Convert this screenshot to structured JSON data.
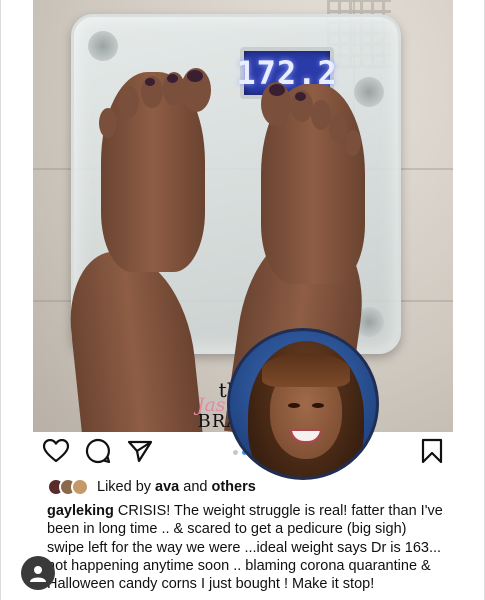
{
  "photo": {
    "scale_reading": "172.2",
    "watermark": {
      "line1": "the",
      "line2": "Jasmine",
      "line3": "BRAND"
    }
  },
  "actions": {
    "icons": [
      "heart-icon",
      "comment-icon",
      "share-icon",
      "bookmark-icon"
    ],
    "carousel_dots": 3,
    "active_dot": 2
  },
  "likes": {
    "prefix": "Liked by ",
    "user": "ava",
    "connector": " and ",
    "others": "others"
  },
  "caption": {
    "username": "gayleking",
    "text": " CRISIS! The weight struggle is real! fatter than I've been in long time .. & scared to get a pedicure (big sigh)  swipe left for the way we were ...ideal weight says Dr is 163... not happening anytime soon .. blaming corona quarantine & Halloween candy corns I just bought !  Make it stop!"
  },
  "colors": {
    "accent_blue": "#3897f0",
    "watermark_pink": "#e28aa3",
    "scale_display": "#2a3aa8"
  }
}
